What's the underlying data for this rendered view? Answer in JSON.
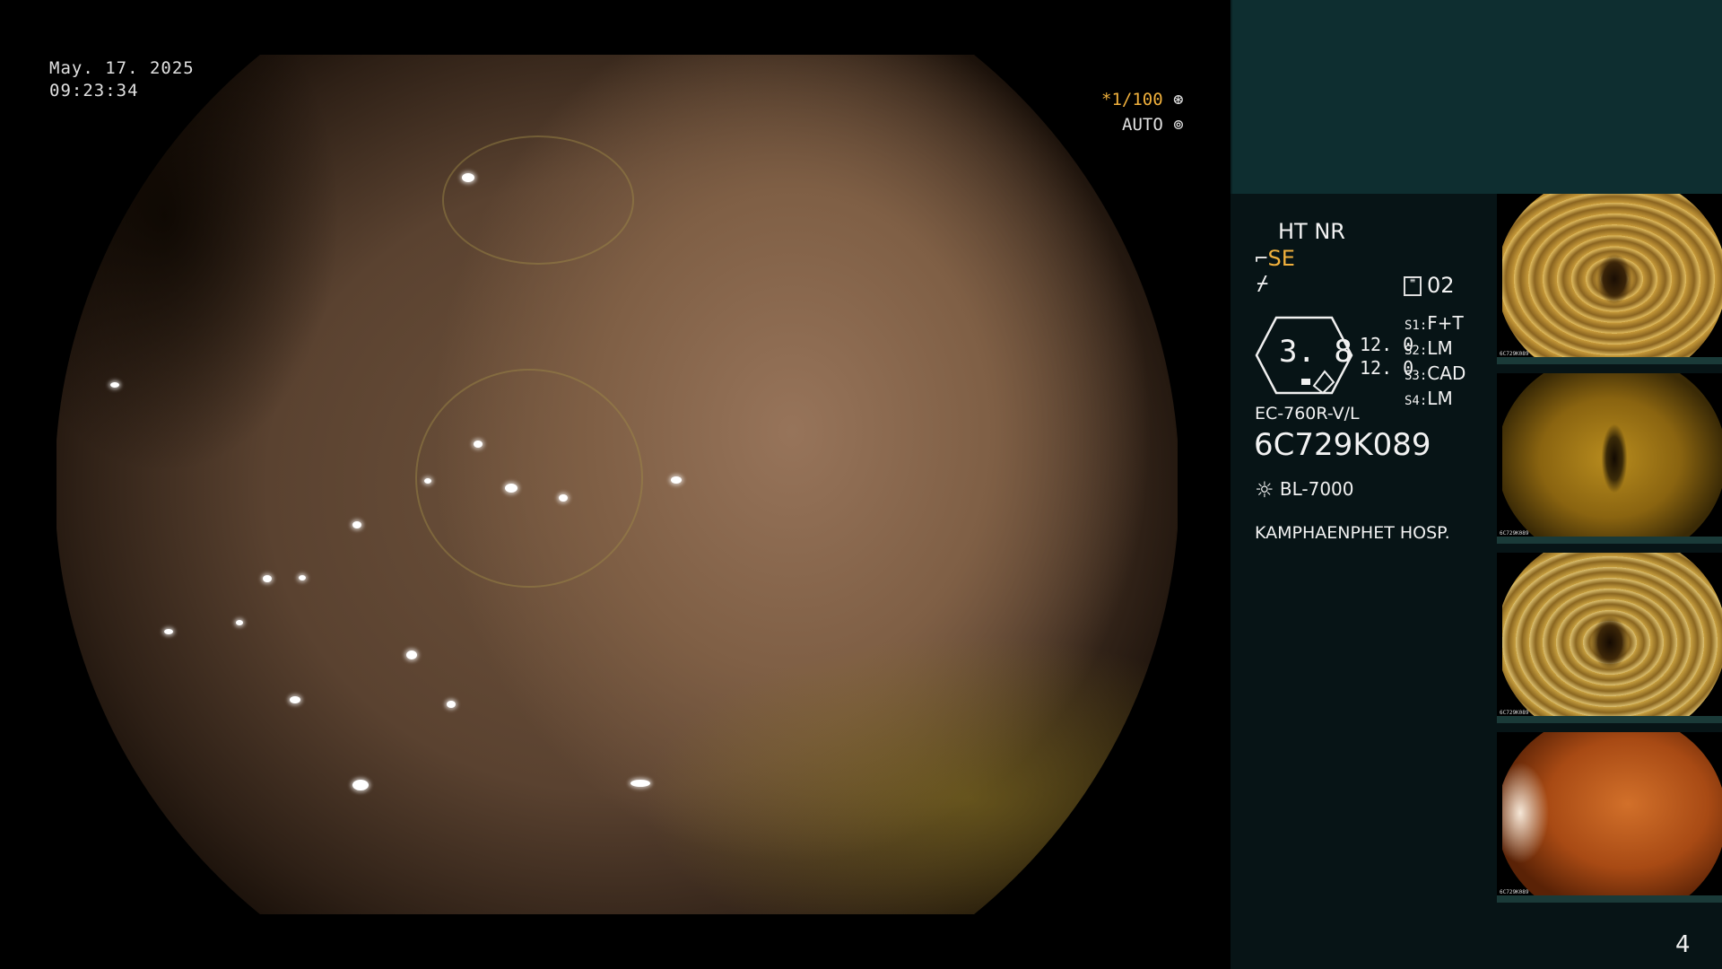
{
  "overlay": {
    "date": "May. 17. 2025",
    "time": "09:23:34",
    "shutter": "*1/100",
    "iris": "AUTO"
  },
  "info": {
    "enhancement": "HT NR",
    "structure": "SE",
    "capture_count": "02",
    "zoom": "3. 8",
    "value_1": "12. 0",
    "value_2": "12. 0",
    "switches": [
      {
        "key": "S1:",
        "value": "F+T"
      },
      {
        "key": "S2:",
        "value": "LM"
      },
      {
        "key": "S3:",
        "value": "CAD"
      },
      {
        "key": "S4:",
        "value": "LM"
      }
    ],
    "scope_model": "EC-760R-V/L",
    "serial": "6C729K089",
    "light_source": "BL-7000",
    "hospital": "KAMPHAENPHET HOSP."
  },
  "thumbnails": [
    {
      "serial": "6C729K089"
    },
    {
      "serial": "6C729K089"
    },
    {
      "serial": "6C729K089"
    },
    {
      "serial": "6C729K089"
    }
  ],
  "page_number": "4",
  "colors": {
    "panel_bg": "#071416",
    "panel_top": "#0e2e30",
    "accent_orange": "#f0b03c",
    "mucosa": "#7f5f45"
  }
}
